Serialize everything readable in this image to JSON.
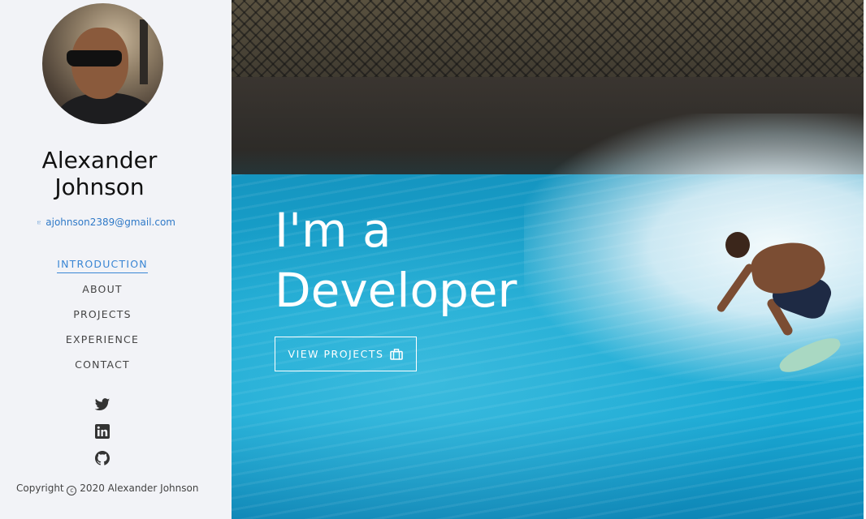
{
  "profile": {
    "name_line1": "Alexander",
    "name_line2": "Johnson",
    "email": "ajohnson2389@gmail.com",
    "email_icon": "envelope-icon"
  },
  "nav": {
    "items": [
      {
        "label": "INTRODUCTION",
        "active": true
      },
      {
        "label": "ABOUT",
        "active": false
      },
      {
        "label": "PROJECTS",
        "active": false
      },
      {
        "label": "EXPERIENCE",
        "active": false
      },
      {
        "label": "CONTACT",
        "active": false
      }
    ],
    "active_color": "#3a86d4"
  },
  "social": [
    "twitter-icon",
    "linkedin-icon",
    "github-icon"
  ],
  "footer": {
    "copyright_prefix": "Copyright",
    "copyright_suffix": "2020 Alexander Johnson"
  },
  "hero": {
    "headline_line1": "I'm a",
    "headline_line2": "Developer",
    "cta_label": "VIEW PROJECTS",
    "cta_icon": "briefcase-icon"
  }
}
